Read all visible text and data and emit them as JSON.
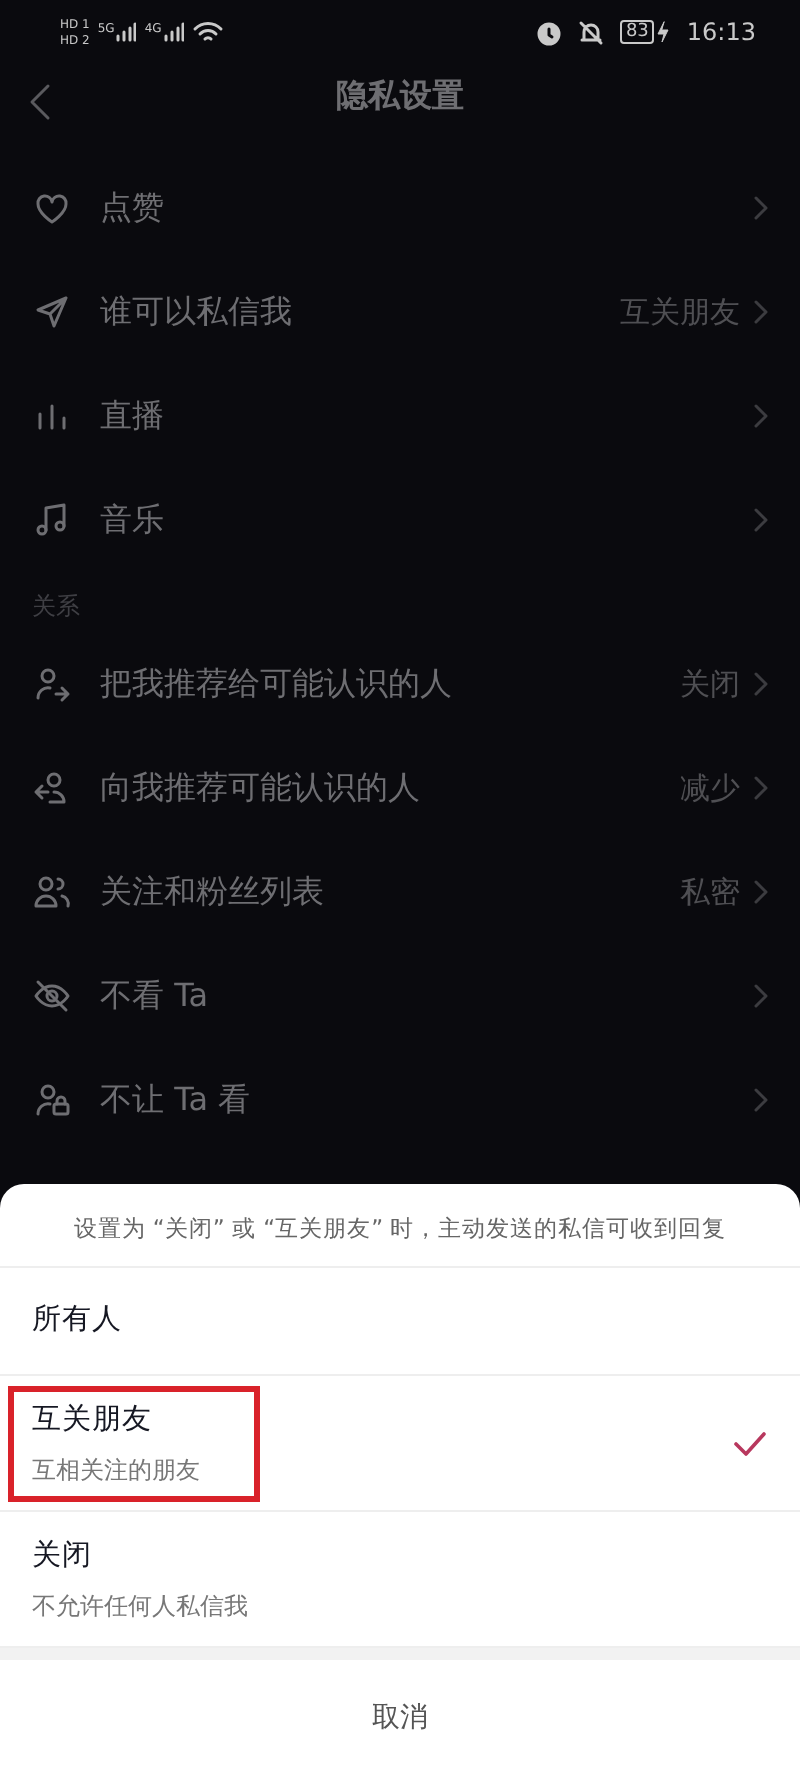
{
  "status_bar": {
    "sims": [
      "HD 1",
      "HD 2"
    ],
    "networks": [
      "5G",
      "4G"
    ],
    "battery": "83",
    "time": "16:13"
  },
  "header": {
    "title": "隐私设置"
  },
  "sections": [
    {
      "items": [
        {
          "label": "点赞"
        },
        {
          "label": "谁可以私信我",
          "value": "互关朋友"
        },
        {
          "label": "直播"
        },
        {
          "label": "音乐"
        }
      ]
    },
    {
      "title": "关系",
      "items": [
        {
          "label": "把我推荐给可能认识的人",
          "value": "关闭"
        },
        {
          "label": "向我推荐可能认识的人",
          "value": "减少"
        },
        {
          "label": "关注和粉丝列表",
          "value": "私密"
        },
        {
          "label": "不看 Ta"
        },
        {
          "label": "不让 Ta 看"
        }
      ]
    }
  ],
  "sheet": {
    "hint": "设置为 “关闭” 或 “互关朋友” 时，主动发送的私信可收到回复",
    "options": [
      {
        "label": "所有人",
        "selected": false,
        "highlighted": false
      },
      {
        "label": "互关朋友",
        "description": "互相关注的朋友",
        "selected": true,
        "highlighted": true
      },
      {
        "label": "关闭",
        "description": "不允许任何人私信我",
        "selected": false,
        "highlighted": false
      }
    ],
    "cancel": "取消"
  }
}
